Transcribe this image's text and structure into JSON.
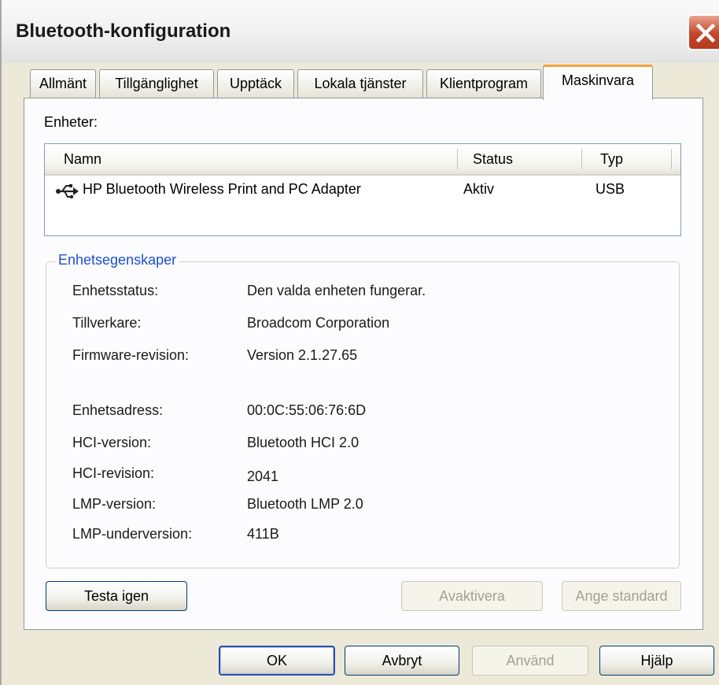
{
  "window": {
    "title": "Bluetooth-konfiguration"
  },
  "tabs": [
    {
      "label": "Allmänt",
      "active": false
    },
    {
      "label": "Tillgänglighet",
      "active": false
    },
    {
      "label": "Upptäck",
      "active": false
    },
    {
      "label": "Lokala tjänster",
      "active": false
    },
    {
      "label": "Klientprogram",
      "active": false
    },
    {
      "label": "Maskinvara",
      "active": true
    }
  ],
  "devices": {
    "label": "Enheter:",
    "columns": [
      "Namn",
      "Status",
      "Typ"
    ],
    "rows": [
      {
        "icon": "usb-icon",
        "name": "HP Bluetooth Wireless Print and PC Adapter",
        "status": "Aktiv",
        "type": "USB"
      }
    ]
  },
  "properties": {
    "title": "Enhetsegenskaper",
    "device_status_label": "Enhetsstatus:",
    "device_status_value": "Den valda enheten fungerar.",
    "manufacturer_label": "Tillverkare:",
    "manufacturer_value": "Broadcom Corporation",
    "firmware_label": "Firmware-revision:",
    "firmware_value": "Version 2.1.27.65",
    "address_label": "Enhetsadress:",
    "address_value": "00:0C:55:06:76:6D",
    "hci_version_label": "HCI-version:",
    "hci_version_value": "Bluetooth HCI 2.0",
    "hci_revision_label": "HCI-revision:",
    "hci_revision_value": "2041",
    "lmp_version_label": "LMP-version:",
    "lmp_version_value": "Bluetooth LMP 2.0",
    "lmp_subversion_label": "LMP-underversion:",
    "lmp_subversion_value": "411B"
  },
  "panel_buttons": {
    "retest": "Testa igen",
    "deactivate": "Avaktivera",
    "set_default": "Ange standard"
  },
  "dialog_buttons": {
    "ok": "OK",
    "cancel": "Avbryt",
    "apply": "Använd",
    "help": "Hjälp"
  },
  "colors": {
    "active_tab_accent": "#f4a33a",
    "group_title": "#1f4fd1",
    "close_button": "#c5452a"
  }
}
